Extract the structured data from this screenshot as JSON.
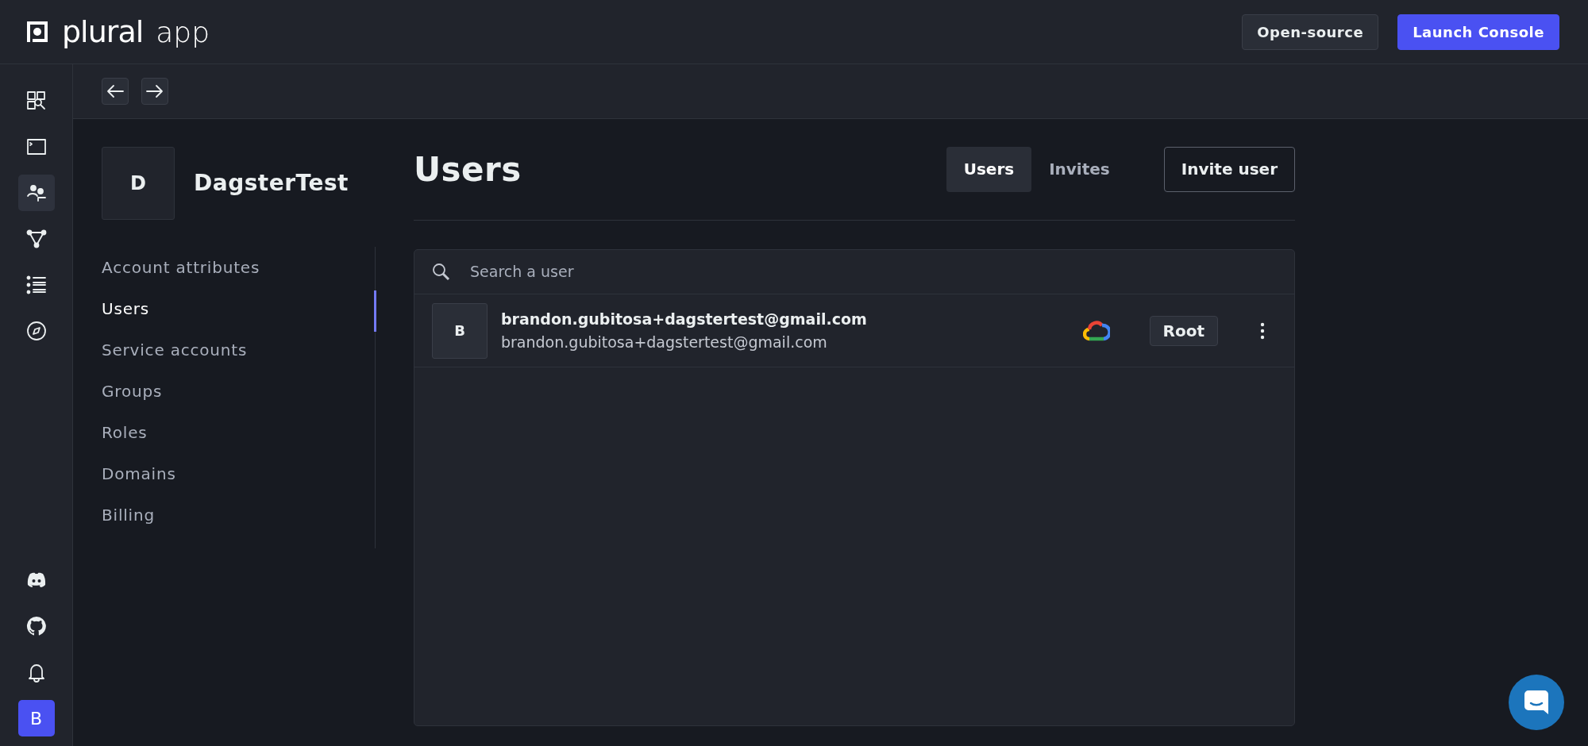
{
  "header": {
    "logo_text": "plural",
    "app_label": "app",
    "buttons": [
      {
        "label": "Open-source",
        "kind": "secondary"
      },
      {
        "label": "Launch Console",
        "kind": "primary"
      }
    ]
  },
  "rail": {
    "items": [
      {
        "selected": false
      },
      {
        "selected": false
      },
      {
        "selected": true
      },
      {
        "selected": false
      },
      {
        "selected": false
      },
      {
        "selected": false
      }
    ],
    "user_initial": "B"
  },
  "account": {
    "initial": "D",
    "name": "DagsterTest"
  },
  "nav": [
    {
      "label": "Account attributes",
      "selected": false
    },
    {
      "label": "Users",
      "selected": true
    },
    {
      "label": "Service accounts",
      "selected": false
    },
    {
      "label": "Groups",
      "selected": false
    },
    {
      "label": "Roles",
      "selected": false
    },
    {
      "label": "Domains",
      "selected": false
    },
    {
      "label": "Billing",
      "selected": false
    }
  ],
  "page": {
    "title": "Users",
    "tabs": [
      {
        "label": "Users",
        "selected": true
      },
      {
        "label": "Invites",
        "selected": false
      }
    ],
    "invite_button": "Invite user"
  },
  "search": {
    "placeholder": "Search a user"
  },
  "users": [
    {
      "initial": "B",
      "name": "brandon.gubitosa+dagstertest@gmail.com",
      "email": "brandon.gubitosa+dagstertest@gmail.com",
      "role": "Root"
    }
  ]
}
